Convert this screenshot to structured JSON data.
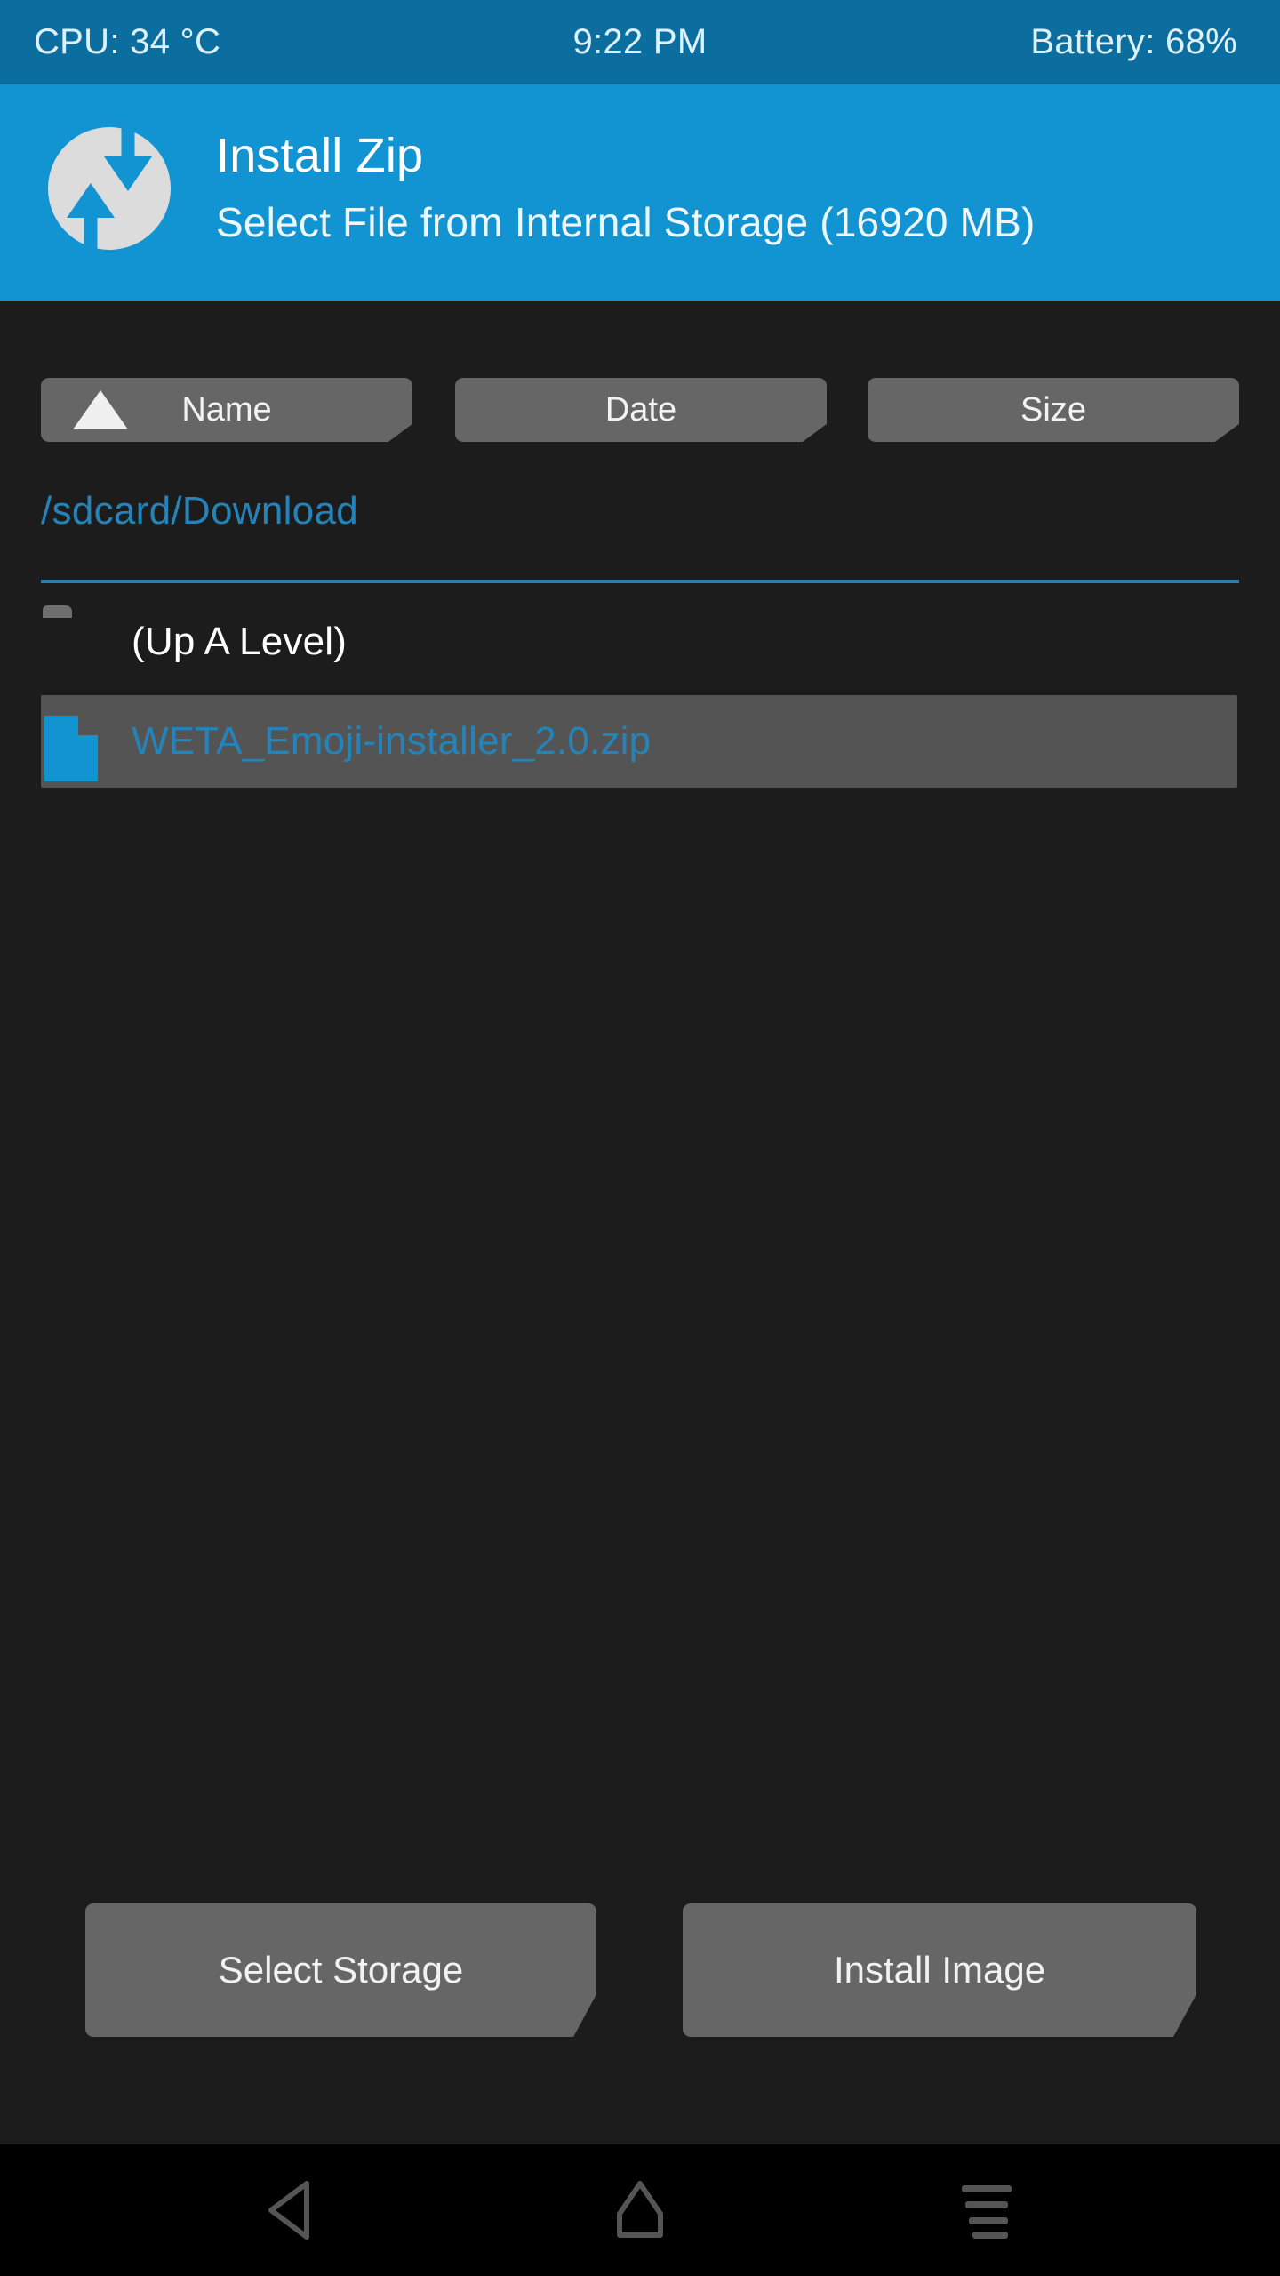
{
  "status_bar": {
    "cpu": "CPU: 34 °C",
    "clock": "9:22 PM",
    "battery": "Battery: 68%",
    "background_color": "#0b6e9e",
    "text_color": "#dff1f8"
  },
  "header": {
    "title": "Install Zip",
    "subtitle": "Select File from Internal Storage (16920 MB)",
    "logo_icon": "twrp-logo-icon",
    "background_color": "#1294d2",
    "title_color": "#ffffff"
  },
  "sort_buttons": [
    {
      "label": "Name",
      "icon": "sort-ascending-triangle-icon",
      "active": true
    },
    {
      "label": "Date",
      "icon": "",
      "active": false
    },
    {
      "label": "Size",
      "icon": "",
      "active": false
    }
  ],
  "path": {
    "value": "/sdcard/Download",
    "color": "#2484ba"
  },
  "file_list": [
    {
      "label": "(Up A Level)",
      "icon": "folder-icon",
      "type": "directory",
      "selected": false
    },
    {
      "label": "WETA_Emoji-installer_2.0.zip",
      "icon": "file-zip-icon",
      "type": "file",
      "selected": true
    }
  ],
  "actions": {
    "select_storage_label": "Select Storage",
    "install_image_label": "Install Image",
    "button_color": "#666666"
  },
  "navigation_bar": {
    "back_icon": "back-triangle-icon",
    "home_icon": "home-icon",
    "recents_icon": "menu-lines-icon",
    "background_color": "#000000",
    "icon_color": "#555555"
  },
  "theme": {
    "page_background": "#1c1c1c",
    "selected_row": "#545454",
    "accent_blue": "#1294d2"
  }
}
